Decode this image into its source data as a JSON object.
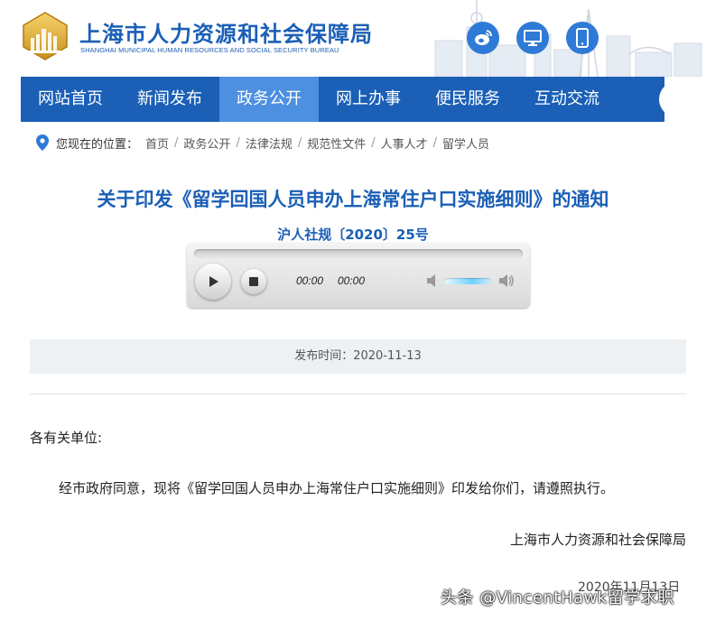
{
  "header": {
    "title": "上海市人力资源和社会保障局",
    "subtitle": "SHANGHAI MUNICIPAL HUMAN RESOURCES AND SOCIAL SECURITY BUREAU",
    "icons": [
      "weibo-icon",
      "desktop-icon",
      "mobile-icon"
    ]
  },
  "nav": {
    "items": [
      "网站首页",
      "新闻发布",
      "政务公开",
      "网上办事",
      "便民服务",
      "互动交流"
    ],
    "active_index": 2
  },
  "breadcrumb": {
    "label": "您现在的位置：",
    "items": [
      "首页",
      "政务公开",
      "法律法规",
      "规范性文件",
      "人事人才",
      "留学人员"
    ],
    "separator": "/"
  },
  "article": {
    "title": "关于印发《留学回国人员申办上海常住户口实施细则》的通知",
    "doc_number": "沪人社规〔2020〕25号",
    "publish_time": "发布时间：2020-11-13",
    "salutation": "各有关单位:",
    "body": "经市政府同意，现将《留学回国人员申办上海常住户口实施细则》印发给你们，请遵照执行。",
    "signature": "上海市人力资源和社会保障局",
    "date": "2020年11月13日"
  },
  "player": {
    "current_time": "00:00",
    "duration": "00:00"
  },
  "watermark": "头条 @VincentHawk留学求职",
  "colors": {
    "brand": "#1b5fb6",
    "nav_active": "#4d8fe0",
    "icon_circle": "#2f7ad6"
  }
}
